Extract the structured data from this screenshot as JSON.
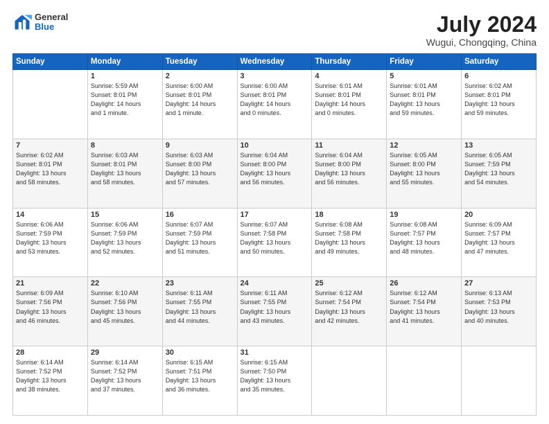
{
  "header": {
    "logo": {
      "general": "General",
      "blue": "Blue"
    },
    "title": "July 2024",
    "subtitle": "Wugui, Chongqing, China"
  },
  "calendar": {
    "headers": [
      "Sunday",
      "Monday",
      "Tuesday",
      "Wednesday",
      "Thursday",
      "Friday",
      "Saturday"
    ],
    "weeks": [
      [
        {
          "day": "",
          "info": ""
        },
        {
          "day": "1",
          "info": "Sunrise: 5:59 AM\nSunset: 8:01 PM\nDaylight: 14 hours\nand 1 minute."
        },
        {
          "day": "2",
          "info": "Sunrise: 6:00 AM\nSunset: 8:01 PM\nDaylight: 14 hours\nand 1 minute."
        },
        {
          "day": "3",
          "info": "Sunrise: 6:00 AM\nSunset: 8:01 PM\nDaylight: 14 hours\nand 0 minutes."
        },
        {
          "day": "4",
          "info": "Sunrise: 6:01 AM\nSunset: 8:01 PM\nDaylight: 14 hours\nand 0 minutes."
        },
        {
          "day": "5",
          "info": "Sunrise: 6:01 AM\nSunset: 8:01 PM\nDaylight: 13 hours\nand 59 minutes."
        },
        {
          "day": "6",
          "info": "Sunrise: 6:02 AM\nSunset: 8:01 PM\nDaylight: 13 hours\nand 59 minutes."
        }
      ],
      [
        {
          "day": "7",
          "info": "Sunrise: 6:02 AM\nSunset: 8:01 PM\nDaylight: 13 hours\nand 58 minutes."
        },
        {
          "day": "8",
          "info": "Sunrise: 6:03 AM\nSunset: 8:01 PM\nDaylight: 13 hours\nand 58 minutes."
        },
        {
          "day": "9",
          "info": "Sunrise: 6:03 AM\nSunset: 8:00 PM\nDaylight: 13 hours\nand 57 minutes."
        },
        {
          "day": "10",
          "info": "Sunrise: 6:04 AM\nSunset: 8:00 PM\nDaylight: 13 hours\nand 56 minutes."
        },
        {
          "day": "11",
          "info": "Sunrise: 6:04 AM\nSunset: 8:00 PM\nDaylight: 13 hours\nand 56 minutes."
        },
        {
          "day": "12",
          "info": "Sunrise: 6:05 AM\nSunset: 8:00 PM\nDaylight: 13 hours\nand 55 minutes."
        },
        {
          "day": "13",
          "info": "Sunrise: 6:05 AM\nSunset: 7:59 PM\nDaylight: 13 hours\nand 54 minutes."
        }
      ],
      [
        {
          "day": "14",
          "info": "Sunrise: 6:06 AM\nSunset: 7:59 PM\nDaylight: 13 hours\nand 53 minutes."
        },
        {
          "day": "15",
          "info": "Sunrise: 6:06 AM\nSunset: 7:59 PM\nDaylight: 13 hours\nand 52 minutes."
        },
        {
          "day": "16",
          "info": "Sunrise: 6:07 AM\nSunset: 7:59 PM\nDaylight: 13 hours\nand 51 minutes."
        },
        {
          "day": "17",
          "info": "Sunrise: 6:07 AM\nSunset: 7:58 PM\nDaylight: 13 hours\nand 50 minutes."
        },
        {
          "day": "18",
          "info": "Sunrise: 6:08 AM\nSunset: 7:58 PM\nDaylight: 13 hours\nand 49 minutes."
        },
        {
          "day": "19",
          "info": "Sunrise: 6:08 AM\nSunset: 7:57 PM\nDaylight: 13 hours\nand 48 minutes."
        },
        {
          "day": "20",
          "info": "Sunrise: 6:09 AM\nSunset: 7:57 PM\nDaylight: 13 hours\nand 47 minutes."
        }
      ],
      [
        {
          "day": "21",
          "info": "Sunrise: 6:09 AM\nSunset: 7:56 PM\nDaylight: 13 hours\nand 46 minutes."
        },
        {
          "day": "22",
          "info": "Sunrise: 6:10 AM\nSunset: 7:56 PM\nDaylight: 13 hours\nand 45 minutes."
        },
        {
          "day": "23",
          "info": "Sunrise: 6:11 AM\nSunset: 7:55 PM\nDaylight: 13 hours\nand 44 minutes."
        },
        {
          "day": "24",
          "info": "Sunrise: 6:11 AM\nSunset: 7:55 PM\nDaylight: 13 hours\nand 43 minutes."
        },
        {
          "day": "25",
          "info": "Sunrise: 6:12 AM\nSunset: 7:54 PM\nDaylight: 13 hours\nand 42 minutes."
        },
        {
          "day": "26",
          "info": "Sunrise: 6:12 AM\nSunset: 7:54 PM\nDaylight: 13 hours\nand 41 minutes."
        },
        {
          "day": "27",
          "info": "Sunrise: 6:13 AM\nSunset: 7:53 PM\nDaylight: 13 hours\nand 40 minutes."
        }
      ],
      [
        {
          "day": "28",
          "info": "Sunrise: 6:14 AM\nSunset: 7:52 PM\nDaylight: 13 hours\nand 38 minutes."
        },
        {
          "day": "29",
          "info": "Sunrise: 6:14 AM\nSunset: 7:52 PM\nDaylight: 13 hours\nand 37 minutes."
        },
        {
          "day": "30",
          "info": "Sunrise: 6:15 AM\nSunset: 7:51 PM\nDaylight: 13 hours\nand 36 minutes."
        },
        {
          "day": "31",
          "info": "Sunrise: 6:15 AM\nSunset: 7:50 PM\nDaylight: 13 hours\nand 35 minutes."
        },
        {
          "day": "",
          "info": ""
        },
        {
          "day": "",
          "info": ""
        },
        {
          "day": "",
          "info": ""
        }
      ]
    ]
  }
}
